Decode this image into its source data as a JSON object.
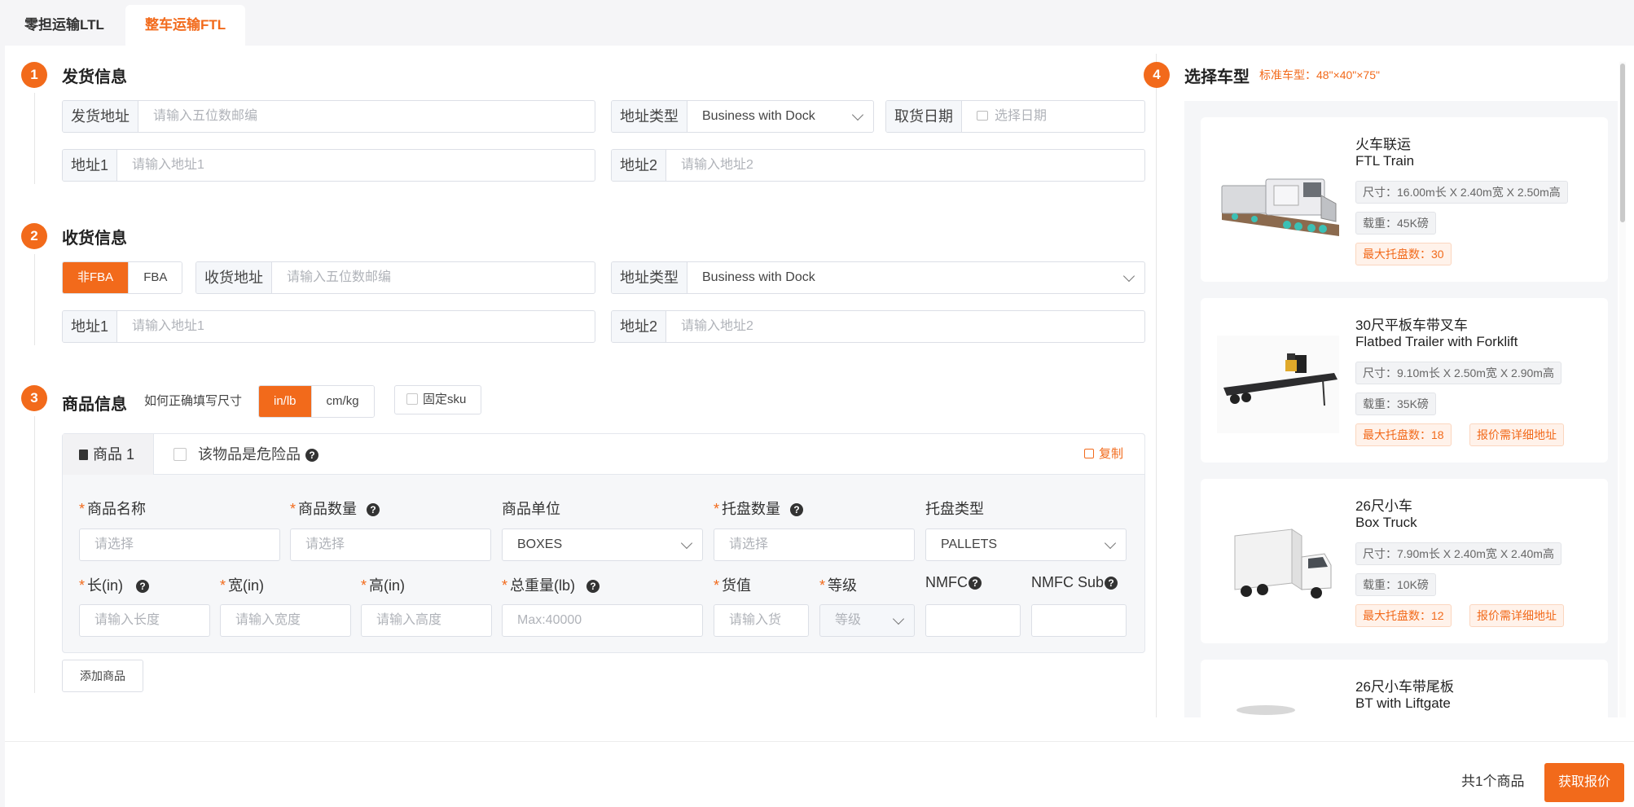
{
  "tabs": [
    {
      "label": "零担运输LTL",
      "active": false
    },
    {
      "label": "整车运输FTL",
      "active": true
    }
  ],
  "steps": [
    "1",
    "2",
    "3",
    "4"
  ],
  "shipper": {
    "title": "发货信息",
    "address_label": "发货地址",
    "address_placeholder": "请输入五位数邮编",
    "type_label": "地址类型",
    "type_value": "Business with Dock",
    "date_label": "取货日期",
    "date_placeholder": "选择日期",
    "addr1_label": "地址1",
    "addr1_placeholder": "请输入地址1",
    "addr2_label": "地址2",
    "addr2_placeholder": "请输入地址2"
  },
  "consignee": {
    "title": "收货信息",
    "toggle": [
      "非FBA",
      "FBA"
    ],
    "address_label": "收货地址",
    "address_placeholder": "请输入五位数邮编",
    "type_label": "地址类型",
    "type_value": "Business with Dock",
    "addr1_label": "地址1",
    "addr1_placeholder": "请输入地址1",
    "addr2_label": "地址2",
    "addr2_placeholder": "请输入地址2"
  },
  "goods": {
    "title": "商品信息",
    "size_help": "如何正确填写尺寸",
    "unit_toggle": [
      "in/lb",
      "cm/kg"
    ],
    "fixed_sku": "固定sku",
    "item_tab": "商品 1",
    "dangerous": "该物品是危险品",
    "copy": "复制",
    "help_mark": "?",
    "required_mark": "*",
    "fields": {
      "name": {
        "label": "商品名称",
        "placeholder": "请选择"
      },
      "qty": {
        "label": "商品数量",
        "placeholder": "请选择"
      },
      "unit": {
        "label": "商品单位",
        "value": "BOXES"
      },
      "pallet_qty": {
        "label": "托盘数量",
        "placeholder": "请选择"
      },
      "pallet_type": {
        "label": "托盘类型",
        "value": "PALLETS"
      },
      "length": {
        "label": "长(in)",
        "placeholder": "请输入长度"
      },
      "width": {
        "label": "宽(in)",
        "placeholder": "请输入宽度"
      },
      "height": {
        "label": "高(in)",
        "placeholder": "请输入高度"
      },
      "weight": {
        "label": "总重量(lb)",
        "placeholder": "Max:40000"
      },
      "value": {
        "label": "货值",
        "placeholder": "请输入货"
      },
      "grade": {
        "label": "等级",
        "placeholder": "等级"
      },
      "nmfc": {
        "label": "NMFC"
      },
      "nmfc_sub": {
        "label": "NMFC Sub"
      }
    },
    "add_button": "添加商品"
  },
  "vehicle": {
    "title": "选择车型",
    "standard": "标准车型：48\"×40\"×75\"",
    "cards": [
      {
        "name_cn": "火车联运",
        "name_en": "FTL Train",
        "size": "尺寸：16.00m长 X 2.40m宽 X 2.50m高",
        "load": "载重：45K磅",
        "max_pallets": "最大托盘数：30",
        "note": ""
      },
      {
        "name_cn": "30尺平板车带叉车",
        "name_en": "Flatbed Trailer with Forklift",
        "size": "尺寸：9.10m长 X 2.50m宽 X 2.90m高",
        "load": "载重：35K磅",
        "max_pallets": "最大托盘数：18",
        "note": "报价需详细地址"
      },
      {
        "name_cn": "26尺小车",
        "name_en": "Box Truck",
        "size": "尺寸：7.90m长 X 2.40m宽 X 2.40m高",
        "load": "载重：10K磅",
        "max_pallets": "最大托盘数：12",
        "note": "报价需详细地址"
      },
      {
        "name_cn": "26尺小车带尾板",
        "name_en": "BT with Liftgate"
      }
    ]
  },
  "footer": {
    "count": "共1个商品",
    "quote_button": "获取报价"
  },
  "colors": {
    "accent": "#f26a1b",
    "border": "#dcdfe6"
  }
}
